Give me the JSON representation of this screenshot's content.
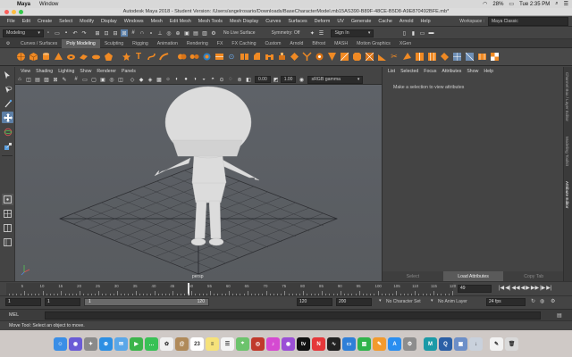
{
  "macos": {
    "menubar": {
      "app": "Maya",
      "window": "Window",
      "battery": "28%",
      "clock": "Tue 2:35 PM"
    },
    "title": "Autodesk Maya 2018 - Student Version: /Users/angelrosario/Downloads/BaseCharacterModel.mb15AS390-B89F-48CE-B5D8-A9E870492BFE.mb*"
  },
  "maya_menu": {
    "items": [
      "File",
      "Edit",
      "Create",
      "Select",
      "Modify",
      "Display",
      "Windows",
      "Mesh",
      "Edit Mesh",
      "Mesh Tools",
      "Mesh Display",
      "Curves",
      "Surfaces",
      "Deform",
      "UV",
      "Generate",
      "Cache",
      "Arnold",
      "Help"
    ],
    "workspace_label": "Workspace :",
    "workspace_value": "Maya Classic"
  },
  "status_line": {
    "menuset": "Modeling",
    "live_surface": "No Live Surface",
    "symmetry": "Symmetry: Off",
    "sign_in": "Sign In"
  },
  "shelf_tabs": [
    "Curves / Surfaces",
    "Poly Modeling",
    "Sculpting",
    "Rigging",
    "Animation",
    "Rendering",
    "FX",
    "FX Caching",
    "Custom",
    "Arnold",
    "Bifrost",
    "MASH",
    "Motion Graphics",
    "XGen"
  ],
  "shelf_active_tab": "Poly Modeling",
  "viewport": {
    "menu": [
      "View",
      "Shading",
      "Lighting",
      "Show",
      "Renderer",
      "Panels"
    ],
    "exposure": "0.00",
    "gamma": "1.00",
    "color_space": "sRGB gamma",
    "camera_label": "persp"
  },
  "attribute_editor": {
    "menu": [
      "List",
      "Selected",
      "Focus",
      "Attributes",
      "Show",
      "Help"
    ],
    "message": "Make a selection to view attributes",
    "buttons": [
      "Select",
      "Load Attributes",
      "Copy Tab"
    ],
    "active_button": "Load Attributes"
  },
  "right_tabs": [
    "Channel Box / Layer Editor",
    "Modeling Toolkit",
    "Attribute Editor"
  ],
  "time_slider": {
    "ticks": [
      "5",
      "10",
      "15",
      "20",
      "25",
      "30",
      "35",
      "40",
      "45",
      "50",
      "55",
      "60",
      "65",
      "70",
      "75",
      "80",
      "85",
      "90",
      "95",
      "100",
      "105",
      "110",
      "115",
      "120"
    ],
    "current_frame": "49",
    "playhead_frame": 49,
    "playback_glyphs": [
      "|◀",
      "◀|",
      "◀◀",
      "◀",
      "▶",
      "▶▶",
      "|▶",
      "▶|"
    ]
  },
  "range_slider": {
    "start": "1",
    "inner_start": "1",
    "range_start_label": "1",
    "range_end_label": "120",
    "end": "120",
    "anim_end": "200",
    "character_set": "No Character Set",
    "anim_layer": "No Anim Layer",
    "fps": "24 fps"
  },
  "command_line": {
    "label": "MEL"
  },
  "help_line": "Move Tool: Select an object to move.",
  "dock": [
    {
      "name": "finder-icon",
      "color": "#3a8ee6",
      "glyph": "☺"
    },
    {
      "name": "siri-icon",
      "color": "#6a5bd6",
      "glyph": "◉"
    },
    {
      "name": "launchpad-icon",
      "color": "#8a8a8a",
      "glyph": "✦"
    },
    {
      "name": "safari-icon",
      "color": "#2d8fe3",
      "glyph": "⊕"
    },
    {
      "name": "mail-icon",
      "color": "#5aa7e8",
      "glyph": "✉"
    },
    {
      "name": "facetime-icon",
      "color": "#3cb44b",
      "glyph": "▶"
    },
    {
      "name": "messages-icon",
      "color": "#39c156",
      "glyph": "…"
    },
    {
      "name": "photos-icon",
      "color": "#f0f0f0",
      "glyph": "✿"
    },
    {
      "name": "contacts-icon",
      "color": "#b08a5a",
      "glyph": "@"
    },
    {
      "name": "calendar-icon",
      "color": "#ffffff",
      "glyph": "23"
    },
    {
      "name": "notes-icon",
      "color": "#f6e27a",
      "glyph": "≡"
    },
    {
      "name": "reminders-icon",
      "color": "#f4f4f4",
      "glyph": "☰"
    },
    {
      "name": "maps-icon",
      "color": "#6cc36c",
      "glyph": "⌖"
    },
    {
      "name": "photobooth-icon",
      "color": "#c0392b",
      "glyph": "◎"
    },
    {
      "name": "itunes-icon",
      "color": "#d54ad1",
      "glyph": "♪"
    },
    {
      "name": "podcasts-icon",
      "color": "#9b4fd6",
      "glyph": "◉"
    },
    {
      "name": "appletv-icon",
      "color": "#111111",
      "glyph": "tv"
    },
    {
      "name": "news-icon",
      "color": "#e5373a",
      "glyph": "N"
    },
    {
      "name": "stocks-icon",
      "color": "#222222",
      "glyph": "∿"
    },
    {
      "name": "keynote-icon",
      "color": "#2f7fd8",
      "glyph": "▭"
    },
    {
      "name": "numbers-icon",
      "color": "#30b34b",
      "glyph": "▥"
    },
    {
      "name": "pages-icon",
      "color": "#f29a2e",
      "glyph": "✎"
    },
    {
      "name": "appstore-icon",
      "color": "#2a8ef0",
      "glyph": "A"
    },
    {
      "name": "system-preferences-icon",
      "color": "#8d8d8d",
      "glyph": "⚙"
    },
    {
      "name": "maya-icon",
      "color": "#1b9aa7",
      "glyph": "M"
    },
    {
      "name": "quicktime-icon",
      "color": "#2b5fa6",
      "glyph": "Q"
    },
    {
      "name": "preview-icon",
      "color": "#6d8fc8",
      "glyph": "▣"
    },
    {
      "name": "downloads-icon",
      "color": "#c9d1dc",
      "glyph": "↓"
    },
    {
      "name": "textedit-icon",
      "color": "#f2f2f2",
      "glyph": "✎"
    },
    {
      "name": "trash-icon",
      "color": "#d9d9d9",
      "glyph": "🗑"
    }
  ],
  "colors": {
    "maya_accent": "#f08a24",
    "maya_teal": "#1b9aa7",
    "active_tab": "#5d5d5d"
  }
}
